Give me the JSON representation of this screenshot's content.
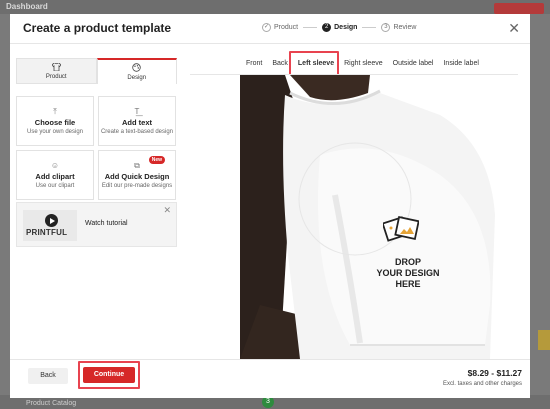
{
  "background": {
    "brand": "Dashboard",
    "top_button": "",
    "catalog_link": "Product Catalog",
    "step_badge": "3"
  },
  "modal": {
    "title": "Create a product template",
    "steps": [
      {
        "number": "1",
        "label": "Product",
        "done": true
      },
      {
        "number": "2",
        "label": "Design",
        "active": true
      },
      {
        "number": "3",
        "label": "Review"
      }
    ]
  },
  "left_panel": {
    "tabs": [
      {
        "label": "Product",
        "icon": "shirt-icon"
      },
      {
        "label": "Design",
        "icon": "palette-icon"
      }
    ],
    "options": [
      {
        "title": "Choose file",
        "sub": "Use your own design",
        "icon": "upload-icon"
      },
      {
        "title": "Add text",
        "sub": "Create a text-based design",
        "icon": "text-icon"
      },
      {
        "title": "Add clipart",
        "sub": "Use our clipart",
        "icon": "smile-icon"
      },
      {
        "title": "Add Quick Design",
        "sub": "Edit our pre-made designs",
        "icon": "layout-icon",
        "badge": "New"
      }
    ],
    "tutorial": {
      "label": "Watch tutorial",
      "thumb_text": "PRINTFUL"
    }
  },
  "view_tabs": [
    {
      "label": "Front"
    },
    {
      "label": "Back"
    },
    {
      "label": "Left sleeve",
      "active": true
    },
    {
      "label": "Right sleeve"
    },
    {
      "label": "Outside label"
    },
    {
      "label": "Inside label"
    }
  ],
  "drop_zone": {
    "line1": "DROP",
    "line2": "YOUR DESIGN",
    "line3": "HERE"
  },
  "footer": {
    "back": "Back",
    "continue": "Continue",
    "price": "$8.29 - $11.27",
    "price_note": "Excl. taxes and other charges"
  },
  "colors": {
    "accent": "#d62828",
    "highlight": "#e8434f"
  }
}
